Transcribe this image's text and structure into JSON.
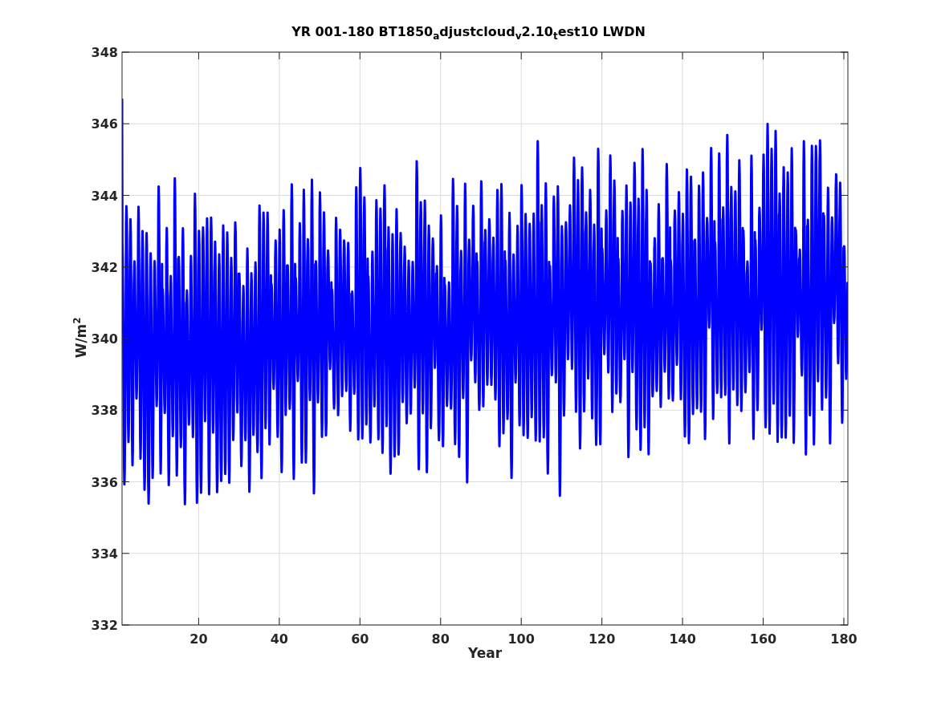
{
  "figure": {
    "title": "YR 001-180 BT1850$_{a}$djustcloud$_{v}$2.10$_{t}$est10 LWDN",
    "ylabel": "W/m$^{2}$",
    "xlabel": "Year",
    "yticks": [
      "348",
      "346",
      "344",
      "342",
      "340",
      "338",
      "336",
      "334",
      "332"
    ],
    "xticks": [
      "20",
      "40",
      "60",
      "80",
      "100",
      "120",
      "140",
      "160",
      "180"
    ]
  }
}
